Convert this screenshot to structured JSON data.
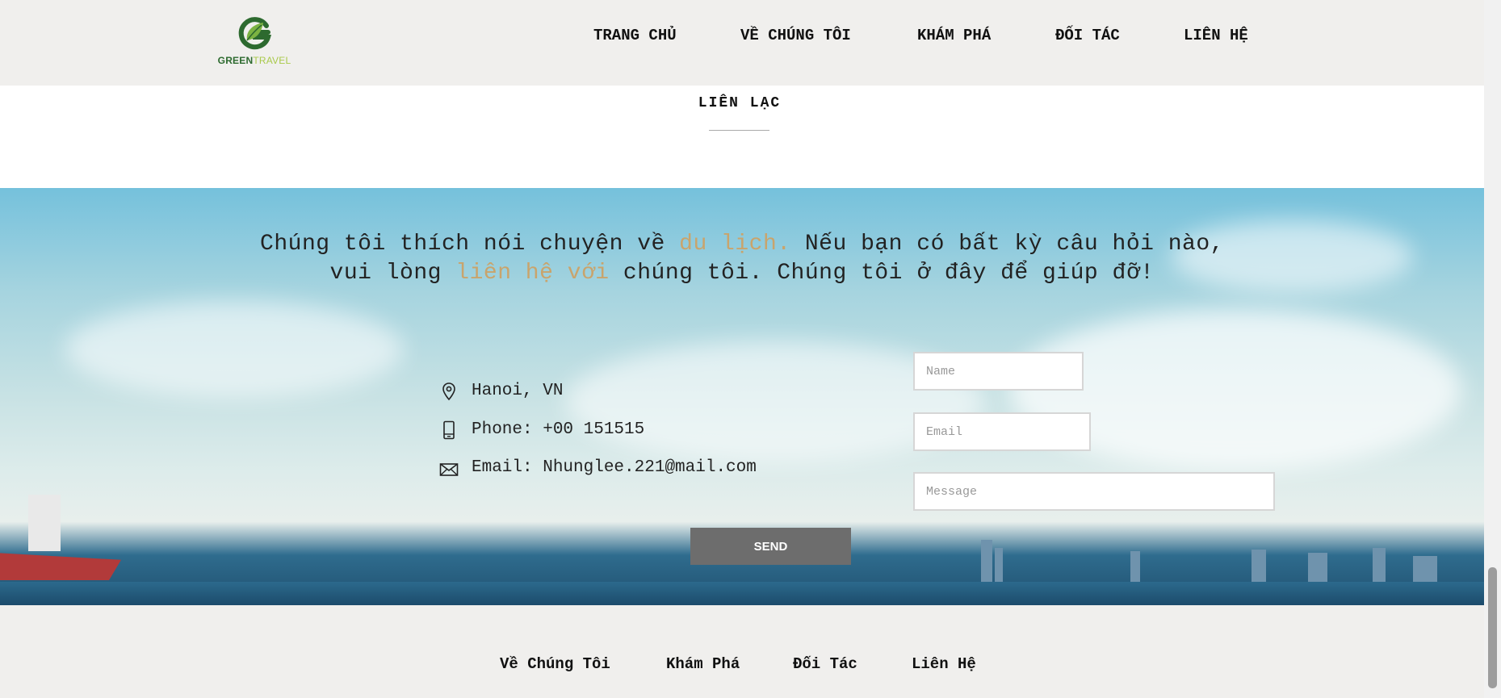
{
  "header": {
    "logo": {
      "text_green": "GREEN",
      "text_travel": "TRAVEL",
      "colors": {
        "green": "#2d6a2f",
        "light_green": "#a9c94a"
      }
    },
    "nav": [
      {
        "label": "TRANG CHỦ"
      },
      {
        "label": "VỀ CHÚNG TÔI"
      },
      {
        "label": "KHÁM PHÁ"
      },
      {
        "label": "ĐỐI TÁC"
      },
      {
        "label": "LIÊN HỆ"
      }
    ]
  },
  "section": {
    "title": "LIÊN LẠC"
  },
  "hero": {
    "line1_a": "Chúng tôi thích nói chuyện về ",
    "line1_highlight": "du lịch.",
    "line1_b": " Nếu bạn có bất kỳ câu hỏi nào,",
    "line2_a": "vui lòng ",
    "line2_highlight": "liên hệ với",
    "line2_b": " chúng tôi. Chúng tôi ở đây để giúp đỡ!",
    "highlight_color": "#c9a46c"
  },
  "contact_info": {
    "location": {
      "icon": "map-pin-icon",
      "text": "Hanoi, VN"
    },
    "phone": {
      "icon": "phone-icon",
      "text": "Phone: +00 151515"
    },
    "email": {
      "icon": "envelope-icon",
      "text": "Email: Nhunglee.221@mail.com"
    }
  },
  "form": {
    "name_placeholder": "Name",
    "email_placeholder": "Email",
    "message_placeholder": "Message",
    "send_label": "SEND"
  },
  "footer": {
    "links": [
      {
        "label": "Về Chúng Tôi"
      },
      {
        "label": "Khám Phá"
      },
      {
        "label": "Đối Tác"
      },
      {
        "label": "Liên Hệ"
      }
    ]
  }
}
